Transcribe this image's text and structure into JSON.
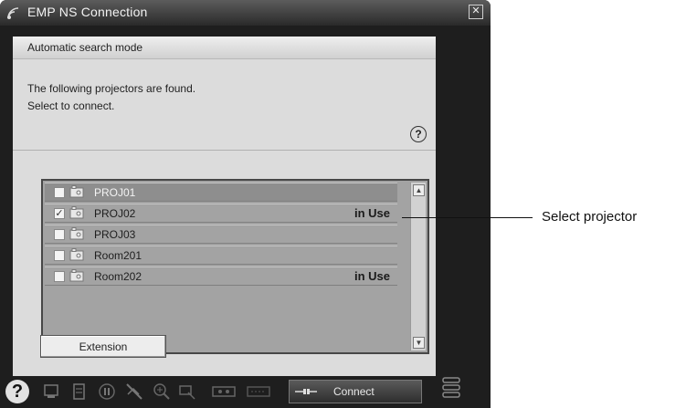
{
  "window": {
    "title": "EMP NS Connection"
  },
  "main": {
    "mode": "Automatic search mode",
    "instruction_line1": "The following projectors are found.",
    "instruction_line2": "Select to connect.",
    "help_label": "?"
  },
  "projectors": [
    {
      "name": "PROJ01",
      "status": "",
      "checked": false,
      "selected": true
    },
    {
      "name": "PROJ02",
      "status": "in Use",
      "checked": true,
      "selected": false
    },
    {
      "name": "PROJ03",
      "status": "",
      "checked": false,
      "selected": false
    },
    {
      "name": "Room201",
      "status": "",
      "checked": false,
      "selected": false
    },
    {
      "name": "Room202",
      "status": "in Use",
      "checked": false,
      "selected": false
    }
  ],
  "extension_label": "Extension",
  "toolbar": {
    "help_label": "?",
    "connect_label": "Connect",
    "icons": [
      "display-icon",
      "document-icon",
      "pause-icon",
      "no-signal-icon",
      "zoom-icon",
      "resize-icon",
      "video-icon",
      "keyboard-icon",
      "menu-icon"
    ]
  },
  "callout": {
    "text": "Select projector"
  },
  "colors": {
    "window_bg": "#1e1e1e",
    "client_bg": "#dcdcdc",
    "list_bg": "#a3a3a3",
    "selected_row": "#8e8e8e"
  }
}
